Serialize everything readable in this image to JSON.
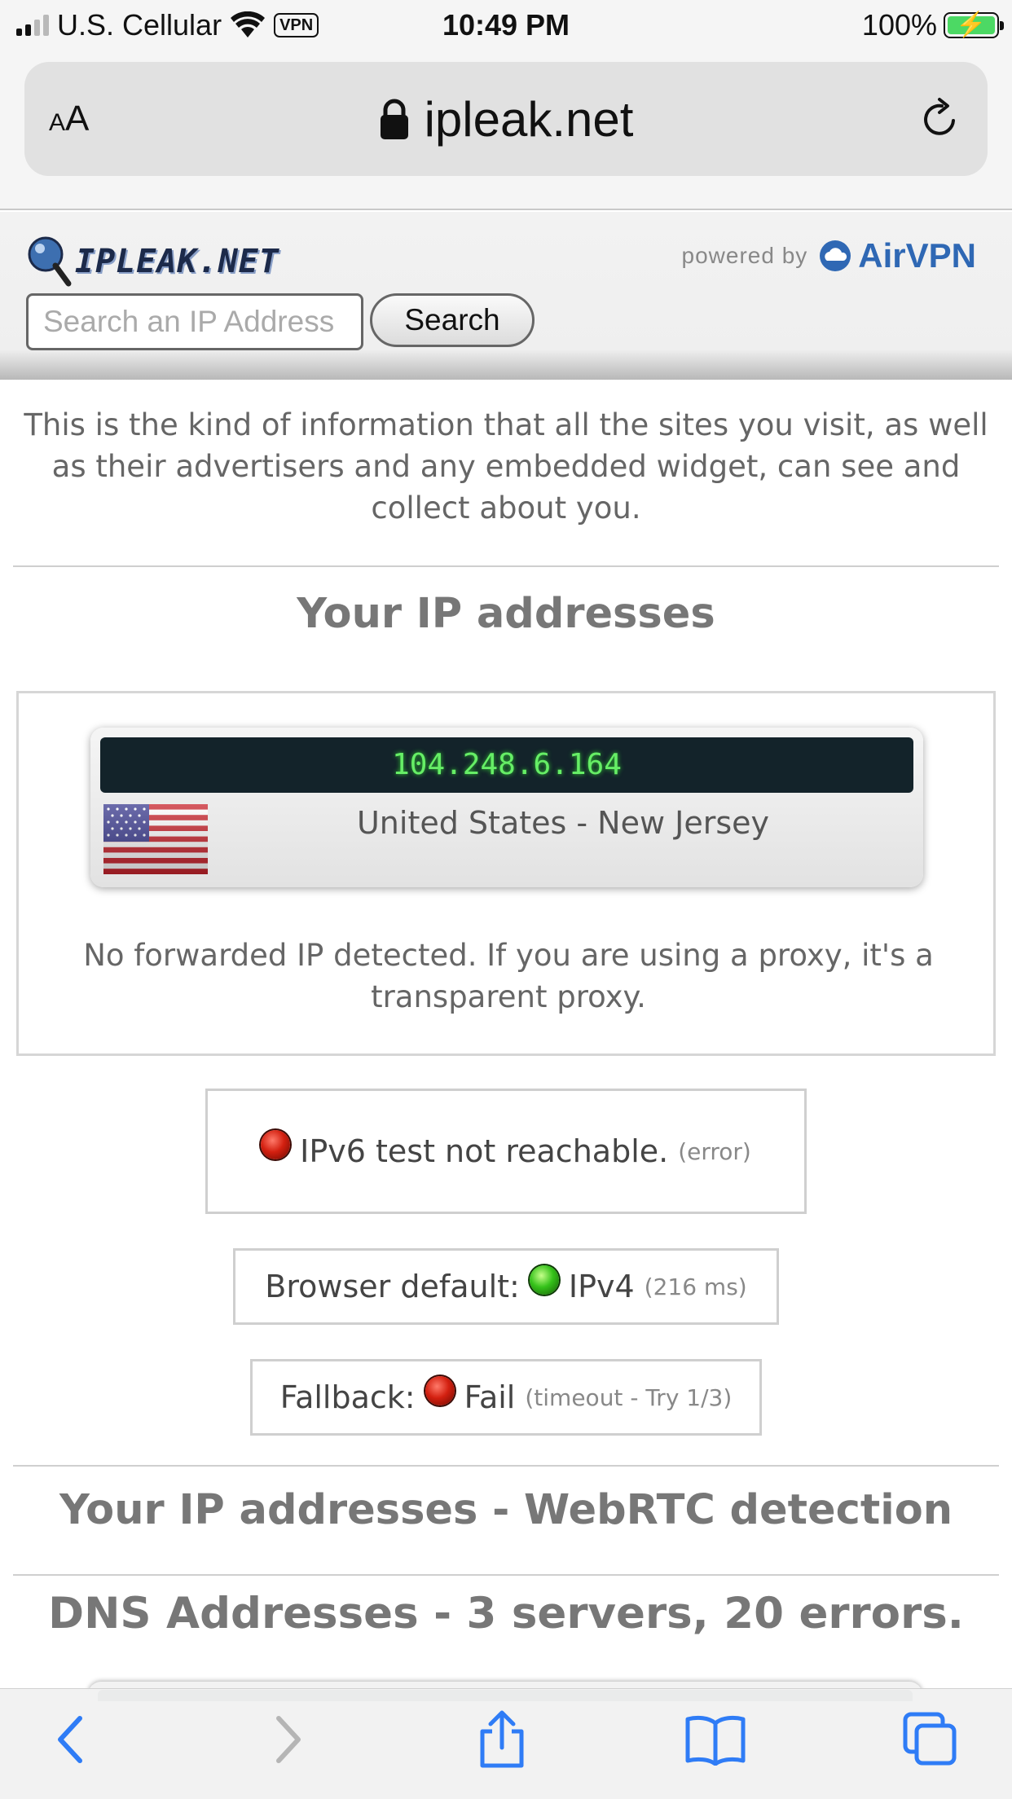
{
  "status_bar": {
    "carrier": "U.S. Cellular",
    "vpn_label": "VPN",
    "time": "10:49 PM",
    "battery_percent": "100%"
  },
  "url_bar": {
    "text_size_small": "A",
    "text_size_big": "A",
    "domain": "ipleak.net"
  },
  "header": {
    "logo_text": "IPLEAK.NET",
    "powered_by": "powered by",
    "partner": "AirVPN",
    "search_placeholder": "Search an IP Address",
    "search_button": "Search"
  },
  "intro_text": "This is the kind of information that all the sites you visit, as well as their advertisers and any embedded widget, can see and collect about you.",
  "ip_section": {
    "title": "Your IP addresses",
    "ip": "104.248.6.164",
    "location": "United States - New Jersey",
    "forwarded_note": "No forwarded IP detected. If you are using a proxy, it's a transparent proxy."
  },
  "tests": {
    "ipv6_text": "IPv6 test not reachable.",
    "ipv6_note": "(error)",
    "default_label": "Browser default:",
    "default_value": "IPv4",
    "default_note": "(216 ms)",
    "fallback_label": "Fallback:",
    "fallback_value": "Fail",
    "fallback_note": "(timeout - Try 1/3)"
  },
  "webrtc_title": "Your IP addresses - WebRTC detection",
  "dns_title": "DNS Addresses - 3 servers, 20 errors.",
  "toolbar": {
    "icons": [
      "back-icon",
      "forward-icon",
      "share-icon",
      "bookmarks-icon",
      "tabs-icon"
    ]
  },
  "colors": {
    "accent": "#2f68b4",
    "ip_text": "#66ee66",
    "status_red": "#d32010",
    "status_green": "#35c21a",
    "battery": "#4cd964"
  }
}
